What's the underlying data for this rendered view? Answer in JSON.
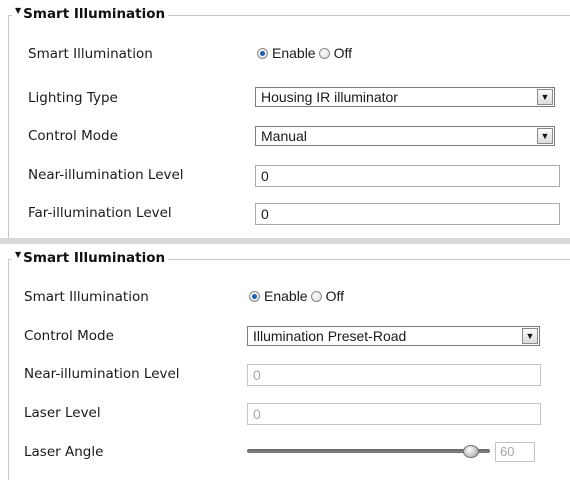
{
  "panel1": {
    "title": "Smart Illumination",
    "rows": [
      {
        "label": "Smart Illumination",
        "options": [
          "Enable",
          "Off"
        ],
        "selected": "Enable"
      },
      {
        "label": "Lighting Type",
        "value": "Housing IR illuminator"
      },
      {
        "label": "Control Mode",
        "value": "Manual"
      },
      {
        "label": "Near-illumination Level",
        "value": "0"
      },
      {
        "label": "Far-illumination Level",
        "value": "0"
      }
    ]
  },
  "panel2": {
    "title": "Smart Illumination",
    "rows": [
      {
        "label": "Smart Illumination",
        "options": [
          "Enable",
          "Off"
        ],
        "selected": "Enable"
      },
      {
        "label": "Control Mode",
        "value": "Illumination Preset-Road"
      },
      {
        "label": "Near-illumination Level",
        "value": "0"
      },
      {
        "label": "Laser Level",
        "value": "0"
      },
      {
        "label": "Laser Angle",
        "value": "60",
        "slider_fraction": 0.92
      }
    ]
  },
  "icons": {
    "collapse": "collapse-triangle-icon",
    "dropdown": "dropdown-arrow-icon",
    "radio_selected": "radio-selected-icon",
    "radio_unselected": "radio-unselected-icon",
    "slider_thumb": "slider-thumb-icon"
  },
  "colors": {
    "radio_dot": "#1e5fae",
    "disabled_text": "#a6a6a6",
    "group_border": "#c7c7c7"
  }
}
